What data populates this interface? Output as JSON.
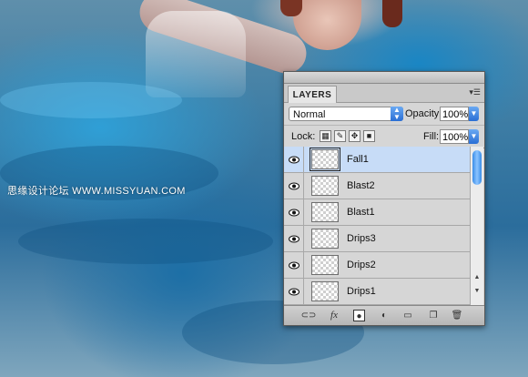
{
  "watermark": "思缘设计论坛 WWW.MISSYUAN.COM",
  "panel": {
    "tab_label": "LAYERS",
    "menu_icon": "panel-menu-icon",
    "blend_mode": "Normal",
    "opacity_label": "Opacity:",
    "opacity_value": "100%",
    "lock_label": "Lock:",
    "fill_label": "Fill:",
    "fill_value": "100%",
    "layers": [
      {
        "name": "Fall1",
        "visible": true,
        "selected": true
      },
      {
        "name": "Blast2",
        "visible": true,
        "selected": false
      },
      {
        "name": "Blast1",
        "visible": true,
        "selected": false
      },
      {
        "name": "Drips3",
        "visible": true,
        "selected": false
      },
      {
        "name": "Drips2",
        "visible": true,
        "selected": false
      },
      {
        "name": "Drips1",
        "visible": true,
        "selected": false
      }
    ],
    "bottom_icons": [
      "link-layers-icon",
      "fx-icon",
      "add-mask-icon",
      "adjustment-layer-icon",
      "new-group-icon",
      "new-layer-icon",
      "trash-icon"
    ],
    "colors": {
      "selected_row": "#c7dcf7",
      "scroll_thumb": "#3a8de8"
    }
  }
}
